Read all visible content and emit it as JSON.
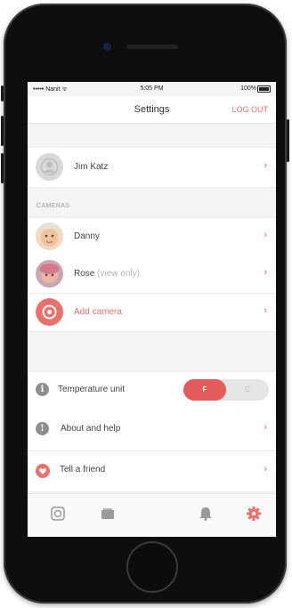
{
  "status_bar": {
    "carrier": "••••• Nanit ᯤ",
    "time": "5:05 PM",
    "battery": "100%"
  },
  "header": {
    "title": "Settings",
    "logout_label": "LOG OUT"
  },
  "profile": {
    "name": "Jim Katz"
  },
  "cameras": {
    "section_title": "CAMERAS",
    "items": [
      {
        "name": "Danny",
        "suffix": ""
      },
      {
        "name": "Rose",
        "suffix": "(view only)"
      }
    ],
    "add_label": "Add camera"
  },
  "settings": {
    "temperature": {
      "label": "Temperature unit",
      "options": [
        "F",
        "C"
      ],
      "selected": "F"
    },
    "about": {
      "label": "About and help"
    },
    "tell": {
      "label": "Tell a friend"
    }
  },
  "chevron": "›",
  "tabs": [
    "camera-tab",
    "memories-tab",
    "night-tab",
    "notifications-tab",
    "settings-tab"
  ],
  "colors": {
    "accent": "#e9706d",
    "toggle_active": "#e35b5b"
  }
}
